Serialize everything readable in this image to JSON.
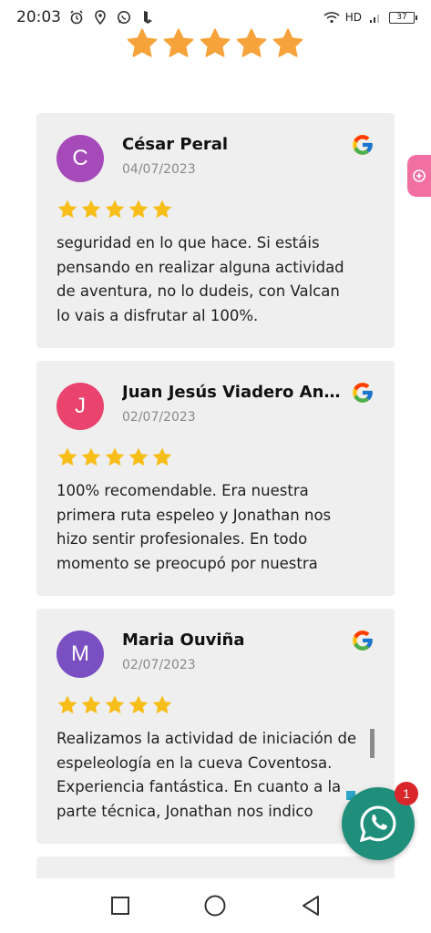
{
  "status_bar": {
    "time": "20:03",
    "network": "HD",
    "battery": "37"
  },
  "reviews": [
    {
      "initial": "C",
      "avatar_color": "#a54ab8",
      "name": "César Peral",
      "date": "04/07/2023",
      "rating": 5,
      "lines": [
        "seguridad en lo que hace. Si estáis",
        "pensando en realizar alguna actividad",
        "de aventura, no lo dudeis, con Valcan",
        "lo vais a disfrutar al 100%."
      ]
    },
    {
      "initial": "J",
      "avatar_color": "#e9436e",
      "name": "Juan Jesús Viadero And...",
      "date": "02/07/2023",
      "rating": 5,
      "lines": [
        "100% recomendable. Era nuestra",
        "primera ruta espeleo y Jonathan nos",
        "hizo sentir profesionales. En todo",
        "momento se preocupó por nuestra"
      ]
    },
    {
      "initial": "M",
      "avatar_color": "#7a4fc2",
      "name": "Maria Ouviña",
      "date": "02/07/2023",
      "rating": 5,
      "lines": [
        "Realizamos la actividad de iniciación de",
        "espeleología en la cueva Coventosa.",
        "Experiencia fantástica. En cuanto a la",
        "parte técnica, Jonathan nos indico"
      ]
    }
  ],
  "whatsapp": {
    "badge_count": "1"
  },
  "colors": {
    "star": "#f7bd18",
    "top_star": "#f5a33a",
    "card_bg": "#efefef",
    "whatsapp": "#1f8f7c"
  }
}
